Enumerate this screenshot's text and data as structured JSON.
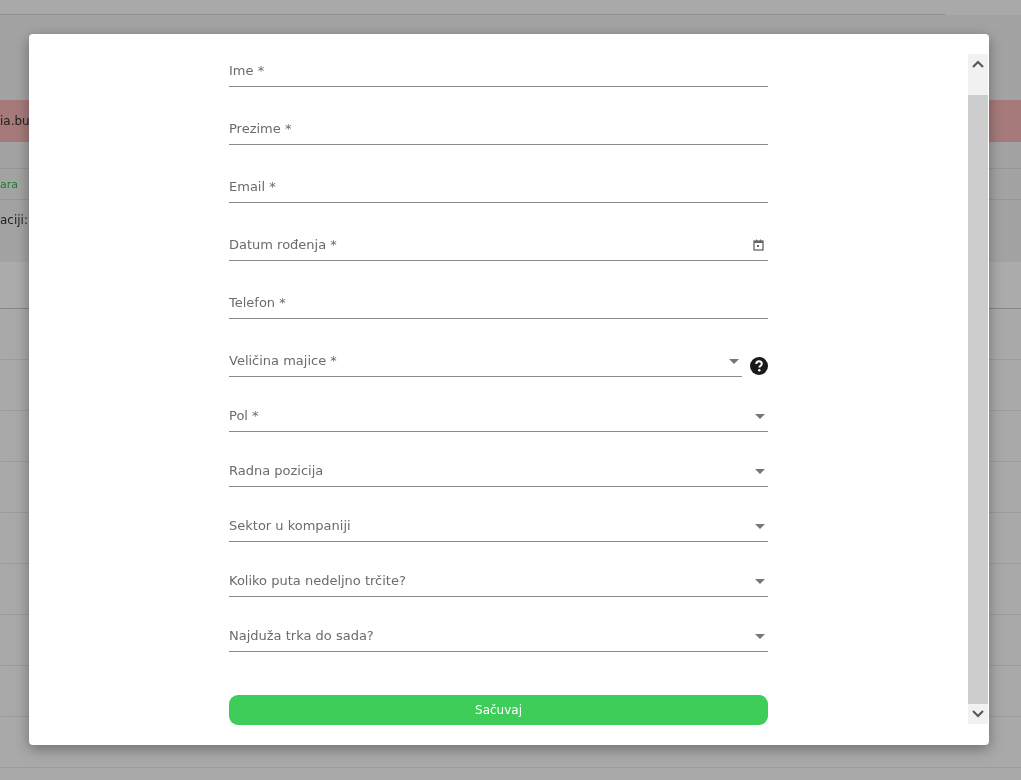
{
  "background": {
    "banner_text": "ia.bu",
    "link_text": "ara",
    "label_text": "aciji:"
  },
  "dialog": {
    "fields": [
      {
        "kind": "text",
        "label": "Ime *"
      },
      {
        "kind": "text",
        "label": "Prezime *"
      },
      {
        "kind": "text",
        "label": "Email *"
      },
      {
        "kind": "date",
        "label": "Datum rođenja *"
      },
      {
        "kind": "text",
        "label": "Telefon *"
      },
      {
        "kind": "select",
        "label": "Veličina majice *",
        "help": true
      },
      {
        "kind": "select",
        "label": "Pol *",
        "help": false
      },
      {
        "kind": "select",
        "label": "Radna pozicija",
        "help": false
      },
      {
        "kind": "select",
        "label": "Sektor u kompaniji",
        "help": false
      },
      {
        "kind": "select",
        "label": "Koliko puta nedeljno trčite?",
        "help": false
      },
      {
        "kind": "select",
        "label": "Najduža trka do sada?",
        "help": false
      }
    ],
    "submit": "Sačuvaj"
  }
}
